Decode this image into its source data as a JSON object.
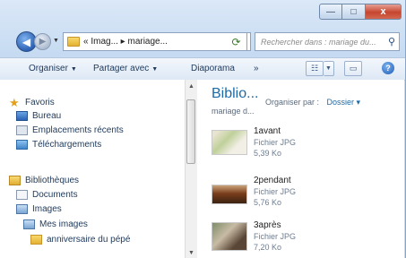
{
  "window": {
    "caption": {
      "minimize": "—",
      "maximize": "□",
      "close": "x"
    }
  },
  "navigation": {
    "back": "◀",
    "forward": "▶",
    "address": "« Imag... ▸ mariage...",
    "search_placeholder": "Rechercher dans : mariage du..."
  },
  "toolbar": {
    "organize": "Organiser",
    "share": "Partager avec",
    "slideshow": "Diaporama",
    "more": "»",
    "help": "?"
  },
  "nav_pane": {
    "favorites": "Favoris",
    "desktop": "Bureau",
    "recent": "Emplacements récents",
    "downloads": "Téléchargements",
    "libraries": "Bibliothèques",
    "documents": "Documents",
    "images": "Images",
    "my_images": "Mes images",
    "birthday_folder": "anniversaire du pépé"
  },
  "content": {
    "library_title": "Biblio...",
    "library_subtitle": "mariage d...",
    "arrange_label": "Organiser par :",
    "arrange_value": "Dossier ▾",
    "files": [
      {
        "name": "1avant",
        "type": "Fichier JPG",
        "size": "5,39 Ko"
      },
      {
        "name": "2pendant",
        "type": "Fichier JPG",
        "size": "5,76 Ko"
      },
      {
        "name": "3après",
        "type": "Fichier JPG",
        "size": "7,20 Ko"
      }
    ]
  },
  "colors": {
    "accent": "#1d6aa8",
    "toolbar_text": "#1e395b",
    "close_button": "#c6452f"
  }
}
